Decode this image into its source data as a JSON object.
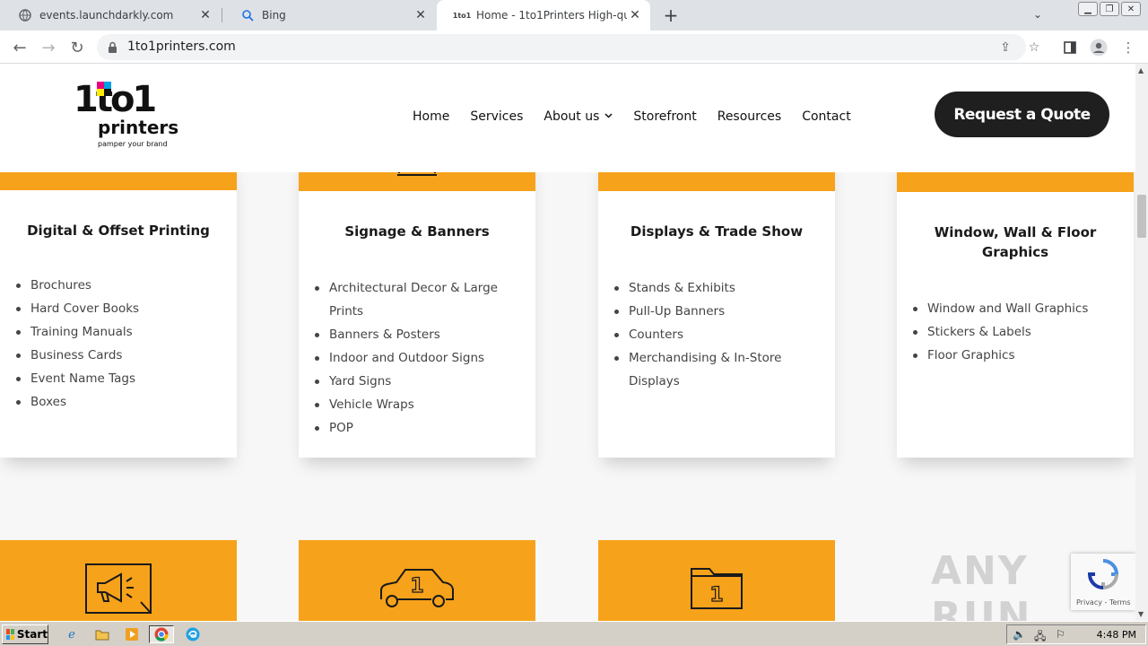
{
  "browser": {
    "tabs": [
      {
        "title": "events.launchdarkly.com",
        "active": false
      },
      {
        "title": "Bing",
        "active": false
      },
      {
        "title": "Home - 1to1Printers High-quality Prin",
        "active": true
      }
    ],
    "new_tab_symbol": "+",
    "url": "1to1printers.com"
  },
  "site": {
    "logo": {
      "line1": "1to1",
      "line2": "printers",
      "tagline": "pamper your brand"
    },
    "nav": [
      {
        "label": "Home"
      },
      {
        "label": "Services"
      },
      {
        "label": "About us"
      },
      {
        "label": "Storefront"
      },
      {
        "label": "Resources"
      },
      {
        "label": "Contact"
      }
    ],
    "cta_label": "Request a Quote",
    "cards": [
      {
        "title": "Digital & Offset Printing",
        "items": [
          "Brochures",
          "Hard Cover Books",
          "Training Manuals",
          "Business Cards",
          "Event Name Tags",
          "Boxes"
        ]
      },
      {
        "title": "Signage & Banners",
        "items": [
          "Architectural Decor & Large Prints",
          "Banners & Posters",
          "Indoor and Outdoor Signs",
          "Yard Signs",
          "Vehicle Wraps",
          "POP"
        ]
      },
      {
        "title": "Displays & Trade Show",
        "items": [
          "Stands & Exhibits",
          "Pull-Up Banners",
          "Counters",
          "Merchandising & In-Store Displays"
        ]
      },
      {
        "title": "Window, Wall & Floor Graphics",
        "items": [
          "Window and Wall Graphics",
          "Stickers & Labels",
          "Floor Graphics"
        ]
      }
    ],
    "bottom_icons": [
      "megaphone-icon",
      "car-icon",
      "folder-icon"
    ],
    "accent_color": "#f7a21b"
  },
  "recaptcha": {
    "text": "Privacy - Terms"
  },
  "watermark": "ANY RUN",
  "taskbar": {
    "start_label": "Start",
    "clock": "4:48 PM"
  }
}
